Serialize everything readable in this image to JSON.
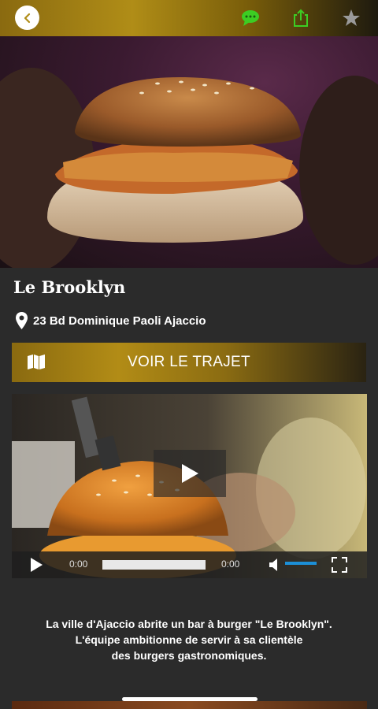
{
  "header": {
    "back_icon": "chevron-left-icon",
    "chat_icon": "chat-bubble-icon",
    "share_icon": "share-icon",
    "favorite_icon": "star-icon",
    "colors": {
      "gold": "#b08d17",
      "chat_green": "#3ccd23",
      "star_gray": "#9a9a9a"
    }
  },
  "restaurant": {
    "name": "Le Brooklyn",
    "address": "23 Bd Dominique Paoli Ajaccio"
  },
  "route_button": {
    "label": "VOIR LE TRAJET",
    "icon": "map-icon"
  },
  "video": {
    "current_time": "0:00",
    "duration": "0:00",
    "progress": 0,
    "volume": 1
  },
  "description": {
    "lines": [
      "La ville d'Ajaccio abrite un bar à burger \"Le Brooklyn\".",
      "L'équipe ambitionne de servir à sa clientèle",
      "des burgers gastronomiques."
    ]
  }
}
